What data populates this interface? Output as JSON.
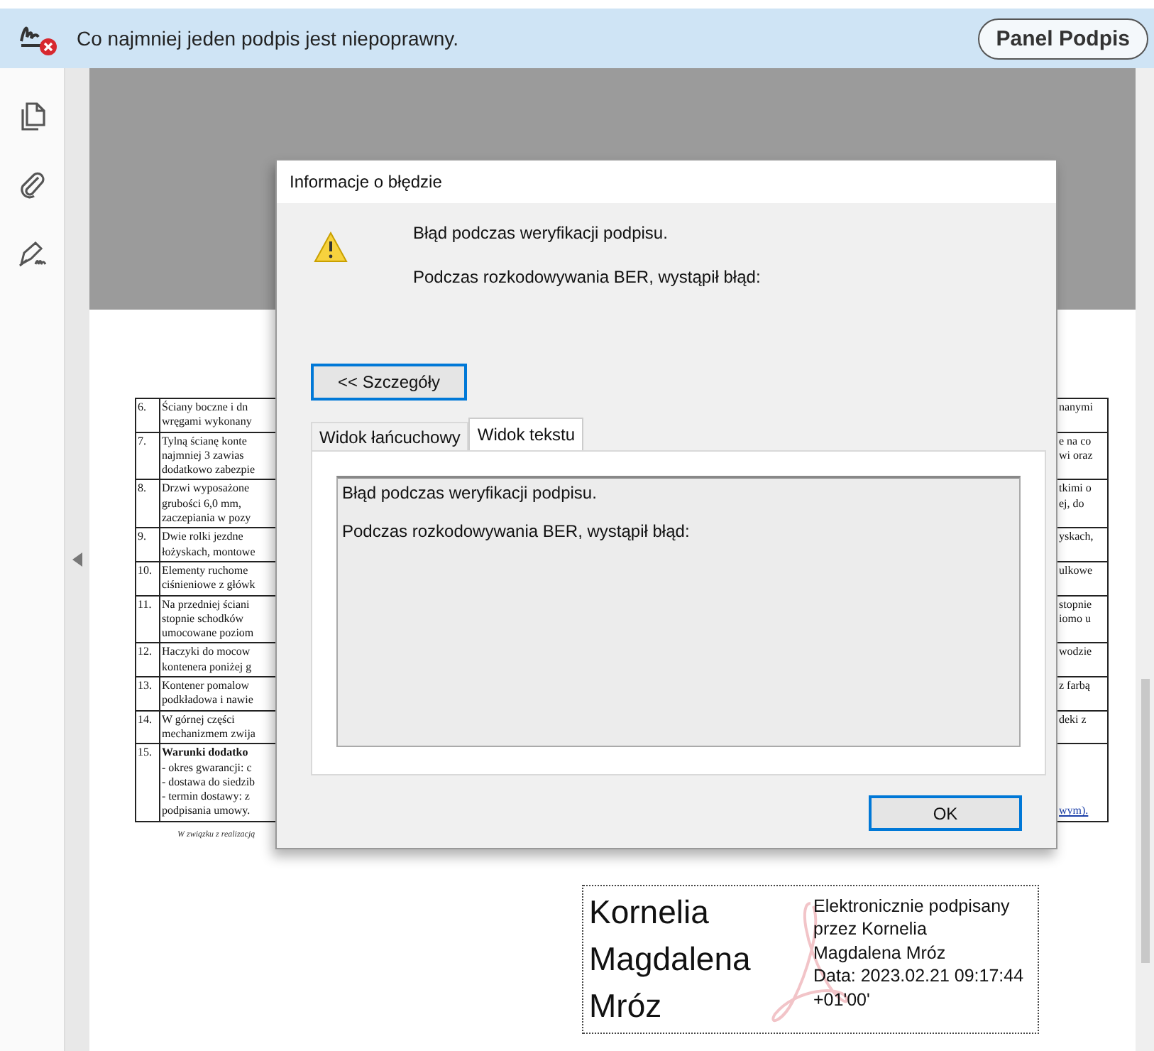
{
  "top_bar": {
    "message": "Co najmniej jeden podpis jest niepoprawny.",
    "button": "Panel Podpis"
  },
  "document": {
    "table": {
      "rows": [
        {
          "number": "6.",
          "left": [
            "Ściany boczne i dn",
            "wręgami wykonany"
          ],
          "right": [
            "nanymi"
          ]
        },
        {
          "number": "7.",
          "left": [
            "Tylną ścianę konte",
            "najmniej 3 zawias",
            "dodatkowo zabezpie"
          ],
          "right": [
            "e na co",
            "wi oraz"
          ]
        },
        {
          "number": "8.",
          "left": [
            "Drzwi  wyposażone",
            "grubości 6,0 mm,",
            "zaczepiania w pozy"
          ],
          "right": [
            "tkimi o",
            "ej,  do"
          ]
        },
        {
          "number": "9.",
          "left": [
            "Dwie rolki jezdne",
            "łożyskach, montowe"
          ],
          "right": [
            "yskach,"
          ]
        },
        {
          "number": "10.",
          "left": [
            "Elementy ruchome",
            "ciśnieniowe z główk"
          ],
          "right": [
            "ulkowe"
          ]
        },
        {
          "number": "11.",
          "left": [
            "Na przedniej ściani",
            "stopnie  schodków",
            "umocowane poziom"
          ],
          "right": [
            "stopnie",
            "iomo u"
          ]
        },
        {
          "number": "12.",
          "left": [
            "Haczyki do mocow",
            "kontenera poniżej g"
          ],
          "right": [
            "wodzie"
          ]
        },
        {
          "number": "13.",
          "left": [
            "Kontener  pomalow",
            "podkładowa i nawie"
          ],
          "right": [
            "z  farbą"
          ]
        },
        {
          "number": "14.",
          "left": [
            "W  górnej  części",
            "mechanizmem zwija"
          ],
          "right": [
            "deki  z"
          ]
        },
        {
          "number": "15.",
          "left": [
            "**Warunki dodatko**",
            "- okres gwarancji: c",
            "- dostawa do siedzib",
            "- termin dostawy: z",
            "podpisania umowy."
          ],
          "right": [
            "wym)."
          ],
          "right_link": true
        }
      ]
    },
    "footnote": "W związku z realizacją",
    "signature": {
      "name": [
        "Kornelia",
        "Magdalena",
        "Mróz"
      ],
      "details": [
        "Elektronicznie podpisany",
        "przez Kornelia",
        "Magdalena Mróz",
        "Data: 2023.02.21 09:17:44",
        "+01'00'"
      ]
    }
  },
  "dialog": {
    "title": "Informacje o błędzie",
    "messages": [
      "Błąd podczas weryfikacji podpisu.",
      "Podczas rozkodowywania BER, wystąpił błąd:"
    ],
    "details_button": "<< Szczegóły",
    "tabs": [
      {
        "label": "Widok łańcuchowy",
        "selected": false
      },
      {
        "label": "Widok tekstu",
        "selected": true
      }
    ],
    "text_view": [
      "Błąd podczas weryfikacji podpisu.",
      "Podczas rozkodowywania BER, wystąpił błąd:"
    ],
    "ok_button": "OK"
  }
}
